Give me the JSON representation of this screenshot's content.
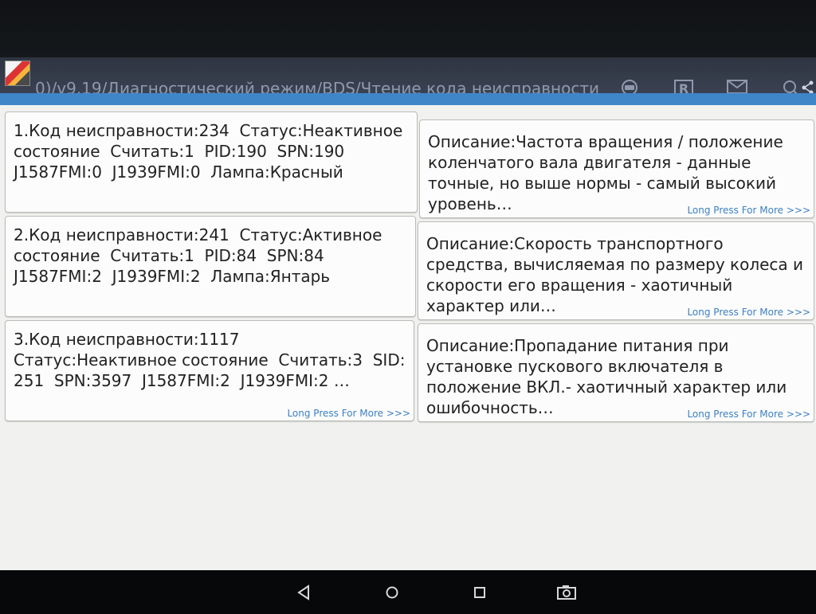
{
  "titlebar": {
    "title": "0)/v9.19/Диагностический режим/BDS/Чтение кода неисправности",
    "icons": [
      "app-icon",
      "obd-icon",
      "report-icon",
      "mail-icon",
      "search-icon",
      "share-icon"
    ],
    "report_glyph": "R"
  },
  "colors": {
    "titlebar": "#2e3440",
    "accent_strip": "#3f86c9",
    "link": "#3d7fc3",
    "card_bg": "#fbfcfb",
    "screen_bg": "#f1f2f0"
  },
  "faults": [
    {
      "code_text": "1.Код неисправности:234  Статус:Неактивное состояние  Считать:1  PID:190  SPN:190  J1587FMI:0  J1939FMI:0  Лампа:Красный",
      "code_more": "",
      "description": "Описание:Частота вращения / положение коленчатого вала двигателя - данные точные, но выше нормы - самый высокий уровень…",
      "description_more": "Long Press For More >>>"
    },
    {
      "code_text": "2.Код неисправности:241  Статус:Активное состояние  Считать:1  PID:84  SPN:84  J1587FMI:2  J1939FMI:2  Лампа:Янтарь",
      "code_more": "",
      "description": "Описание:Скорость транспортного средства, вычисляемая по размеру колеса и скорости его вращения - хаотичный характер или…",
      "description_more": "Long Press For More >>>"
    },
    {
      "code_text": "3.Код неисправности:1117\nСтатус:Неактивное состояние  Считать:3  SID: 251  SPN:3597  J1587FMI:2  J1939FMI:2 …",
      "code_more": "Long Press For More >>>",
      "description": "Описание:Пропадание питания при установке пускового включателя в положение ВКЛ.- хаотичный характер или ошибочность…",
      "description_more": "Long Press For More >>>"
    }
  ],
  "navbar": {
    "buttons": [
      "back-icon",
      "home-icon",
      "recents-icon",
      "screenshot-icon"
    ]
  }
}
